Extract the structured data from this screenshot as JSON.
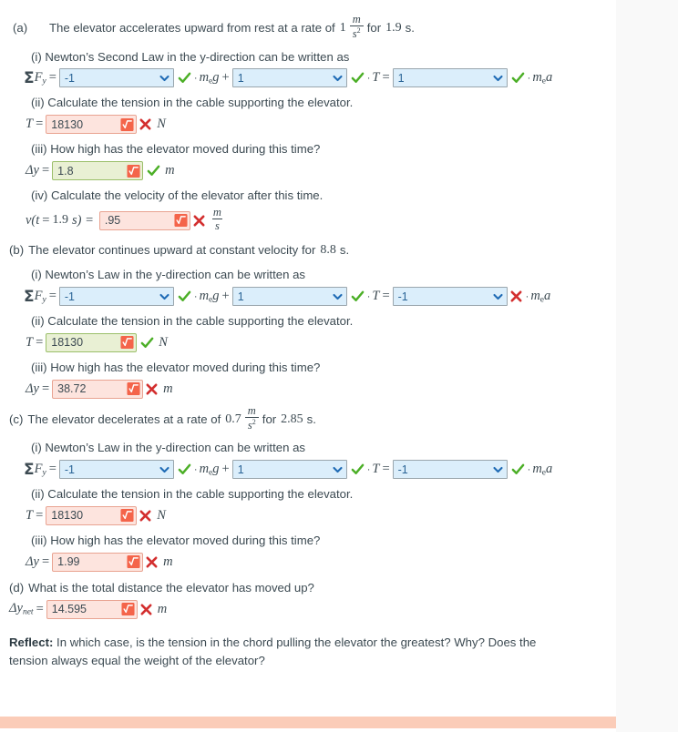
{
  "parts": {
    "a": {
      "label": "(a)",
      "text_before": "The elevator accelerates upward from rest at a rate of",
      "rate_value": "1",
      "rate_num": "m",
      "rate_den": "s",
      "rate_den_exp": "2",
      "text_mid": "for",
      "time_value": "1.9",
      "time_unit": "s.",
      "law_text": "(i) Newton’s Second Law in the y-direction can be written as",
      "eq_lhs_sigma": "Σ",
      "eq_lhs_var": "F",
      "eq_lhs_sub": "y",
      "select1": "-1",
      "select1_mark": "check",
      "term1": "mₑg",
      "plus": "+",
      "select2": "1",
      "select2_mark": "check",
      "term2": "T",
      "select3": "1",
      "select3_mark": "check",
      "term3": "mₑa",
      "q2": "(ii) Calculate the tension in the cable supporting the elevator.",
      "t_label": "T",
      "t_value": "18130",
      "t_state": "wrong",
      "t_mark": "cross",
      "t_unit": "N",
      "q3": "(iii) How high has the elevator moved during this time?",
      "dy_label": "Δy",
      "dy_value": "1.8",
      "dy_state": "right",
      "dy_mark": "check",
      "dy_unit": "m",
      "q4": "(iv) Calculate the velocity of the elevator after this time.",
      "v_label_pre": "v(t",
      "v_label_eq": "=",
      "v_label_time": "1.9",
      "v_label_post": "s) =",
      "v_value": ".95",
      "v_state": "wrong",
      "v_mark": "cross",
      "v_unit_num": "m",
      "v_unit_den": "s"
    },
    "b": {
      "label": "(b)",
      "text": "The elevator continues upward at constant velocity for",
      "time_value": "8.8",
      "time_unit": "s.",
      "law_text": "(i) Newton’s Law in the y-direction can be written as",
      "select1": "-1",
      "select1_mark": "check",
      "select2": "1",
      "select2_mark": "check",
      "select3": "-1",
      "select3_mark": "cross",
      "q2": "(ii) Calculate the tension in the cable supporting the elevator.",
      "t_value": "18130",
      "t_state": "right",
      "t_mark": "check",
      "t_unit": "N",
      "q3": "(iii) How high has the elevator moved during this time?",
      "dy_value": "38.72",
      "dy_state": "wrong",
      "dy_mark": "cross",
      "dy_unit": "m"
    },
    "c": {
      "label": "(c)",
      "text_before": "The elevator decelerates at a rate of",
      "rate_value": "0.7",
      "rate_num": "m",
      "rate_den": "s",
      "rate_den_exp": "2",
      "text_mid": "for",
      "time_value": "2.85",
      "time_unit": "s.",
      "law_text": "(i) Newton’s Law in the y-direction can be written as",
      "select1": "-1",
      "select1_mark": "check",
      "select2": "1",
      "select2_mark": "check",
      "select3": "-1",
      "select3_mark": "check",
      "q2": "(ii) Calculate the tension in the cable supporting the elevator.",
      "t_value": "18130",
      "t_state": "wrong",
      "t_mark": "cross",
      "t_unit": "N",
      "q3": "(iii) How high has the elevator moved during this time?",
      "dy_value": "1.99",
      "dy_state": "wrong",
      "dy_mark": "cross",
      "dy_unit": "m"
    },
    "d": {
      "label": "(d)",
      "text": "What is the total distance the elevator has moved up?",
      "dy_label": "Δy",
      "dy_sub": "net",
      "dy_value": "14.595",
      "dy_state": "wrong",
      "dy_mark": "cross",
      "dy_unit": "m"
    }
  },
  "reflect": {
    "title": "Reflect:",
    "text": "In which case, is the tension in the chord pulling the elevator the greatest? Why? Does the tension always equal the weight of the elevator?"
  },
  "symbols": {
    "equals": "=",
    "plus": "+",
    "dot": "·"
  },
  "colors": {
    "wrong_bg": "#fde4de",
    "wrong_border": "#e9a391",
    "right_bg": "#e9f0d4",
    "right_border": "#9bbf6a",
    "select_bg": "#dbeefb",
    "check_green": "#4caf27",
    "cross_red": "#d32f2f",
    "calc_icon": "#f4644a",
    "bottom_bar": "#fbccb8",
    "text": "#3c4a52"
  }
}
